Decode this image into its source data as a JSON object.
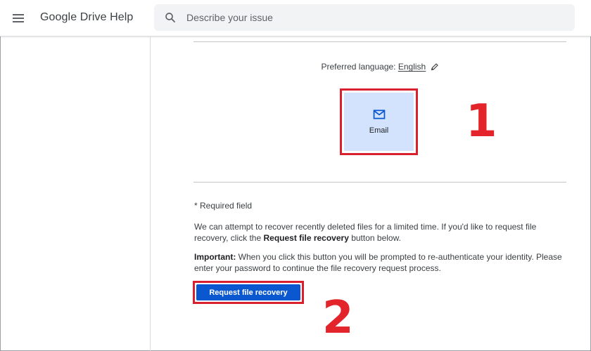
{
  "header": {
    "title": "Google Drive Help",
    "search_placeholder": "Describe your issue"
  },
  "icons": {
    "menu": "menu-icon",
    "search": "search-icon",
    "pencil": "pencil-icon",
    "email": "mail-icon"
  },
  "language": {
    "label": "Preferred language:",
    "value": "English"
  },
  "contact_options": [
    {
      "label": "Email",
      "selected": true
    }
  ],
  "annotations": {
    "step1": "1",
    "step2": "2"
  },
  "form": {
    "required_note": "* Required field",
    "description_pre": "We can attempt to recover recently deleted files for a limited time. If you'd like to request file recovery, click the ",
    "description_bold": "Request file recovery",
    "description_post": " button below.",
    "important_label": "Important:",
    "important_text": " When you click this button you will be prompted to re-authenticate your identity. Please enter your password to continue the file recovery request process.",
    "button_label": "Request file recovery"
  },
  "colors": {
    "accent_blue": "#0b57d0",
    "highlight_red": "#e3242b",
    "email_tile": "#d3e3fd"
  }
}
